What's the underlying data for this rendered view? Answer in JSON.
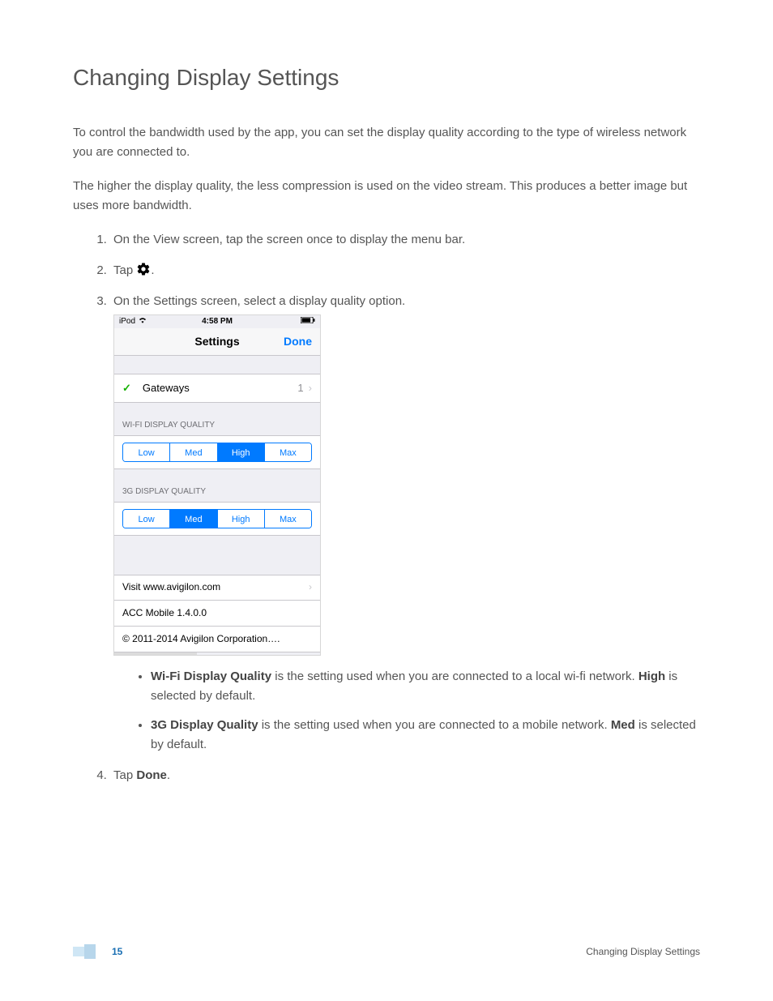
{
  "title": "Changing Display Settings",
  "para1": "To control the bandwidth used by the app, you can set the display quality according to the type of wireless network you are connected to.",
  "para2": "The higher the display quality, the less compression is used on the video stream. This produces a better image but uses more bandwidth.",
  "steps": {
    "s1": "On the View screen, tap the screen once to display the menu bar.",
    "s2_prefix": "Tap ",
    "s2_suffix": ".",
    "s3": "On the Settings screen, select a display quality option.",
    "s4_prefix": "Tap ",
    "s4_bold": "Done",
    "s4_suffix": "."
  },
  "bullets": {
    "b1_bold": "Wi-Fi Display Quality",
    "b1_mid": " is the setting used when you are connected to a local wi-fi network. ",
    "b1_bold2": "High",
    "b1_tail": " is selected by default.",
    "b2_bold": "3G Display Quality",
    "b2_mid": " is the setting used when you are connected to a mobile network. ",
    "b2_bold2": "Med",
    "b2_tail": " is selected by default."
  },
  "phone": {
    "status": {
      "carrier": "iPod",
      "time": "4:58 PM"
    },
    "nav": {
      "title": "Settings",
      "done": "Done"
    },
    "gateways": {
      "label": "Gateways",
      "count": "1"
    },
    "wifi_header": "WI-FI DISPLAY QUALITY",
    "g3_header": "3G DISPLAY QUALITY",
    "seg": {
      "low": "Low",
      "med": "Med",
      "high": "High",
      "max": "Max"
    },
    "wifi_selected": "high",
    "g3_selected": "med",
    "visit": "Visit www.avigilon.com",
    "version": "ACC Mobile 1.4.0.0",
    "copyright": "© 2011-2014 Avigilon Corporation…."
  },
  "footer": {
    "page": "15",
    "right": "Changing Display Settings"
  }
}
